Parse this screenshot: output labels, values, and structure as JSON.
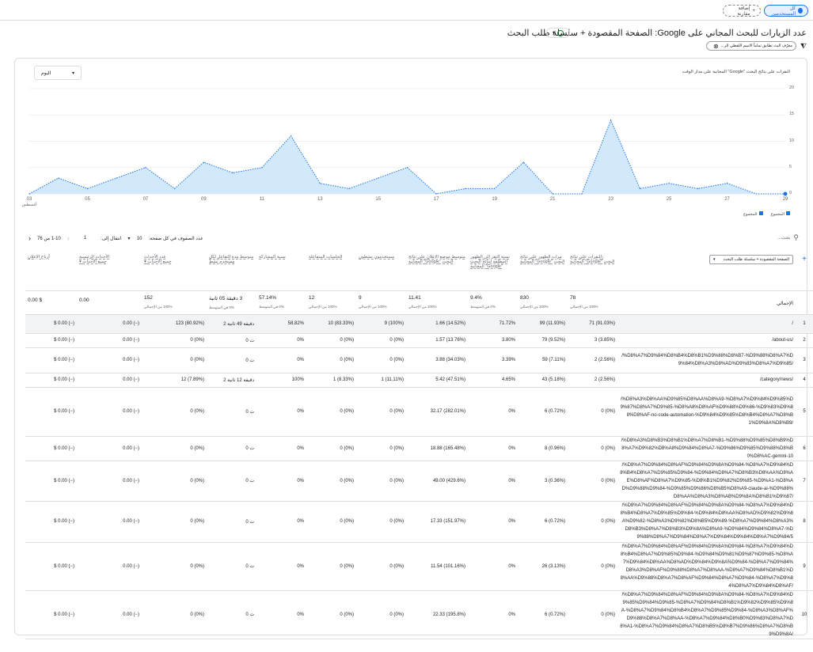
{
  "header": {
    "segment_all": "كل المستخدمين",
    "add_comparison": "إضافة مقارنة",
    "report_title": "عدد الزيارات للبحث المجاني على Google: الصفحة المقصودة + سلسلة طلب البحث",
    "filter_chip": "معرّف البث تطابق تماماً الاسم اللفظي الر..."
  },
  "chart": {
    "period_select": "اليوم",
    "title": "النقرات على نتائج البحث \"Google\" المجانية على مدار الوقت",
    "legend": [
      "المجموع",
      "المجموع"
    ]
  },
  "chart_data": {
    "type": "area",
    "title": "النقرات على نتائج البحث \"Google\" المجانية على مدار الوقت",
    "xlabel": "",
    "ylabel": "",
    "ylim": [
      0,
      20
    ],
    "y_ticks": [
      "0",
      "5",
      "10",
      "15",
      "20"
    ],
    "x_tick_labels": [
      "03",
      "05",
      "07",
      "09",
      "11",
      "13",
      "15",
      "17",
      "19",
      "21",
      "23",
      "25",
      "27",
      "29"
    ],
    "x_sub_label": "أغسطس",
    "x": [
      "03",
      "04",
      "05",
      "06",
      "07",
      "08",
      "09",
      "10",
      "11",
      "12",
      "13",
      "14",
      "15",
      "16",
      "17",
      "18",
      "19",
      "20",
      "21",
      "22",
      "23",
      "24",
      "25",
      "26",
      "27",
      "28",
      "29"
    ],
    "series": [
      {
        "values": [
          0,
          3,
          1,
          3,
          5,
          1,
          6,
          4,
          5,
          11,
          2,
          1,
          3,
          5,
          0,
          1,
          1,
          6,
          0,
          0,
          14,
          1,
          2,
          1,
          2,
          0,
          0
        ]
      }
    ]
  },
  "table": {
    "search_placeholder": "بحث...",
    "rows_per_page_label": "عدد الصفوف في كل صفحة:",
    "rows_per_page": "10",
    "goto_label": "انتقال إلى:",
    "goto_value": "1",
    "range": "1-10 من 76",
    "dimension": "الصفحة المقصودة + سلسلة طلب البحث",
    "total_label": "الإجمالي",
    "columns": [
      "النقرات على نتائج البحث \"Google\" المجانية",
      "مرات الظهور على نتائج البحث \"Google\" المجانية",
      "نسبة النقر إلى الظهور المطلقة لنتائج البحث \"Google\" المجانية",
      "متوسط موضع الإعلان على نتائج البحث \"Google\" المجانية",
      "مستخدمون نشطون",
      "الجلسات المتفاعلة",
      "نسبة المشاركة",
      "متوسط مدة التفاعل لكل مستخدم نشط",
      "عدد الأحداث",
      "الأحداث الرئيسية",
      "أرباح الإعلان"
    ],
    "event_selects": [
      "جميع الأحداث",
      "جميع الأحداث"
    ],
    "totals": [
      {
        "v": "78",
        "s": "100% من الإجمالي"
      },
      {
        "v": "830",
        "s": "100% من الإجمالي"
      },
      {
        "v": "9.4%",
        "s": "0% في المتوسط"
      },
      {
        "v": "11.41",
        "s": "100% من الإجمالي"
      },
      {
        "v": "9",
        "s": "100% من الإجمالي"
      },
      {
        "v": "12",
        "s": "100% من الإجمالي"
      },
      {
        "v": "57.14%",
        "s": "0% في المتوسط"
      },
      {
        "v": "3 دقيقة 05 ثانية",
        "s": "0% في المتوسط"
      },
      {
        "v": "152",
        "s": "100% من الإجمالي"
      },
      {
        "v": "0.00",
        "s": ""
      },
      {
        "v": "$ 0.00",
        "s": ""
      }
    ],
    "rows": [
      {
        "n": "1",
        "page": "/",
        "cells": [
          "71 (91.03%)",
          "99 (11.93%)",
          "71.72%",
          "1.66 (14.52%)",
          "9 (100%)",
          "10 (83.33%)",
          "58.82%",
          "2 دقيقة 49 ثانية",
          "123 (80.92%)",
          "0.00 (−)",
          "$ 0.00 (−)"
        ]
      },
      {
        "n": "2",
        "page": "/about-us/",
        "cells": [
          "3 (3.85%)",
          "79 (9.52%)",
          "3.80%",
          "1.57 (13.76%)",
          "0 (0%)",
          "0 (0%)",
          "0%",
          "0 ث",
          "0 (0%)",
          "0.00 (−)",
          "$ 0.00 (−)"
        ]
      },
      {
        "n": "3",
        "page": "/%D8%A7%D9%84%D8%B4%D8%B1%D9%88%D8%B7-%D9%88%D8%A7%D9%84%D8%A3%D8%AD%D9%83%D8%A7%D9%85/",
        "cells": [
          "2 (2.56%)",
          "59 (7.11%)",
          "3.39%",
          "3.88 (34.03%)",
          "0 (0%)",
          "0 (0%)",
          "0%",
          "0 ث",
          "0 (0%)",
          "0.00 (−)",
          "$ 0.00 (−)"
        ]
      },
      {
        "n": "4",
        "page": "/category/news/",
        "cells": [
          "2 (2.56%)",
          "43 (5.18%)",
          "4.65%",
          "5.42 (47.51%)",
          "1 (11.11%)",
          "1 (8.33%)",
          "100%",
          "2 دقيقة 12 ثانية",
          "12 (7.89%)",
          "0.00 (−)",
          "$ 0.00 (−)"
        ]
      },
      {
        "n": "5",
        "page": "/%D8%A3%D8%AA%D9%85%D8%AA%D8%A9-%D8%A7%D9%84%D9%85%D9%87%D8%A7%D9%85-%D8%A8%D8%AF%D9%88%D9%86-%D9%83%D9%88%D8%AF-no-code-automation-%D9%84%D9%85%D8%B4%D8%A7%D8%B1%D9%8A%D8%B9/",
        "cells": [
          "0 (0%)",
          "6 (0.72%)",
          "0%",
          "32.17 (282.01%)",
          "0 (0%)",
          "0 (0%)",
          "0%",
          "0 ث",
          "0 (0%)",
          "0.00 (−)",
          "$ 0.00 (−)"
        ]
      },
      {
        "n": "6",
        "page": "/%D8%A3%D8%B3%D8%B1%D8%A7%D8%B1-%D9%88%D9%85%D8%B9%D8%A7%D9%82%D8%A8%D9%84%D8%A7-%D9%86%D9%85%D9%88%D8%B0%D8%AC-gemini-10",
        "cells": [
          "0 (0%)",
          "8 (0.96%)",
          "0%",
          "18.88 (165.48%)",
          "0 (0%)",
          "0 (0%)",
          "0%",
          "0 ث",
          "0 (0%)",
          "0.00 (−)",
          "$ 0.00 (−)"
        ]
      },
      {
        "n": "7",
        "page": "/%D8%A7%D9%84%D8%AF%D9%84%D9%8A%D9%84-%D8%A7%D9%84%D8%B4%D8%A7%D9%85%D9%84-%D9%84%D8%A7%D8%B3%D8%AA%D8%AE%D8%AF%D8%A7%D9%85-%D8%B1%D9%82%D9%85-%D9%A1-%D8%AD%D9%88%D9%84-%D9%85%D9%86%D8%B5%D8%A9-claude-ai-%D9%88%D8%AA%D8%A3%D8%AB%D9%8A%D8%B1%D9%87/",
        "cells": [
          "0 (0%)",
          "3 (0.36%)",
          "0%",
          "49.00 (429.6%)",
          "0 (0%)",
          "0 (0%)",
          "0%",
          "0 ث",
          "0 (0%)",
          "0.00 (−)",
          "$ 0.00 (−)"
        ]
      },
      {
        "n": "8",
        "page": "/%D8%A7%D9%84%D8%AF%D9%84%D9%8A%D9%84-%D8%A7%D9%84%D8%B4%D8%A7%D9%85%D9%84-%D9%84%D8%AA%D8%AD%D9%82%D9%8A%D9%82-%D8%A3%D9%82%D8%B5%D9%89-%D8%A7%D9%84%D8%A3%D8%B3%D8%A7%D8%B3%D9%8A%D8%A9-%D9%84%D9%84%D8%A7-%D9%88%D8%A7%D9%84%D8%A7%D9%84%D9%84%D8%A7%D9%84/5",
        "cells": [
          "0 (0%)",
          "6 (0.72%)",
          "0%",
          "17.33 (151.97%)",
          "0 (0%)",
          "0 (0%)",
          "0%",
          "0 ث",
          "0 (0%)",
          "0.00 (−)",
          "$ 0.00 (−)"
        ]
      },
      {
        "n": "9",
        "page": "/%D8%A7%D9%84%D8%AF%D9%84%D9%8A%D9%84-%D8%A7%D9%84%D8%B4%D8%A7%D9%85%D9%84-%D9%84%D9%81%D9%87%D9%85-%D8%A7%D9%84%D8%AA%D8%AD%D9%84%D9%8A%D9%84-%D8%A7%D9%84%D8%A3%D8%AF%D9%88%D8%A7%D8%AA-%D8%A7%D9%84%D8%B1%D8%AA%D9%88%D8%A7%D8%AF%D9%84%D8%A7%D9%84-%D8%A7%D9%84%D8%A7%D9%84%D8%AF/",
        "cells": [
          "0 (0%)",
          "26 (3.13%)",
          "0%",
          "11.54 (101.16%)",
          "0 (0%)",
          "0 (0%)",
          "0%",
          "0 ث",
          "0 (0%)",
          "0.00 (−)",
          "$ 0.00 (−)"
        ]
      },
      {
        "n": "10",
        "page": "/%D8%A7%D9%84%D8%AF%D9%84%D9%8A%D9%84-%D8%A7%D9%84%D9%85%D9%84%D9%85-%D8%A7%D9%84%D8%B1%D9%82%D9%85%D9%8A-%D8%A7%D9%84%D8%B4%D8%A7%D9%85%D9%84-%D8%A3%D8%AF%D9%88%D8%A7%D8%AA-%D8%A7%D9%84%D8%B0%D9%83%D8%A7%D8%A1-%D8%A7%D9%84%D8%A7%D8%B5%D8%B7%D9%86%D8%A7%D8%B9%D9%8A/",
        "cells": [
          "0 (0%)",
          "6 (0.72%)",
          "0%",
          "22.33 (195.8%)",
          "0 (0%)",
          "0 (0%)",
          "0%",
          "0 ث",
          "0 (0%)",
          "0.00 (−)",
          "$ 0.00 (−)"
        ]
      }
    ]
  },
  "colors": {
    "accent": "#1a73e8",
    "area_fill": "#d2e8fb",
    "area_line": "#1a73e8"
  }
}
